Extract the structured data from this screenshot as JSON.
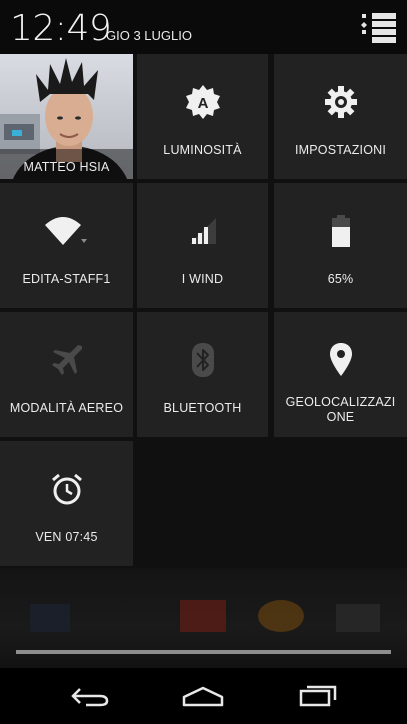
{
  "status": {
    "time": "12:49",
    "date": "GIO 3 LUGLIO"
  },
  "tiles": {
    "profile": {
      "label": "MATTEO HSIA"
    },
    "brightness": {
      "label": "LUMINOSITÀ",
      "icon": "brightness-auto-icon"
    },
    "settings": {
      "label": "IMPOSTAZIONI",
      "icon": "gear-icon"
    },
    "wifi": {
      "label": "EDITA-STAFF1",
      "icon": "wifi-icon"
    },
    "signal": {
      "label": "I WIND",
      "icon": "cell-signal-icon"
    },
    "battery": {
      "label": "65%",
      "icon": "battery-icon",
      "level_percent": 65
    },
    "airplane": {
      "label": "MODALITÀ AEREO",
      "icon": "airplane-icon"
    },
    "bluetooth": {
      "label": "BLUETOOTH",
      "icon": "bluetooth-icon"
    },
    "location": {
      "label": "GEOLOCALIZZAZIONE",
      "icon": "location-pin-icon"
    },
    "alarm": {
      "label": "VEN 07:45",
      "icon": "alarm-clock-icon"
    }
  },
  "colors": {
    "tile_bg": "#222222",
    "panel_bg": "#101010",
    "text": "#ececec",
    "dim_icon": "#4a4a4a"
  }
}
